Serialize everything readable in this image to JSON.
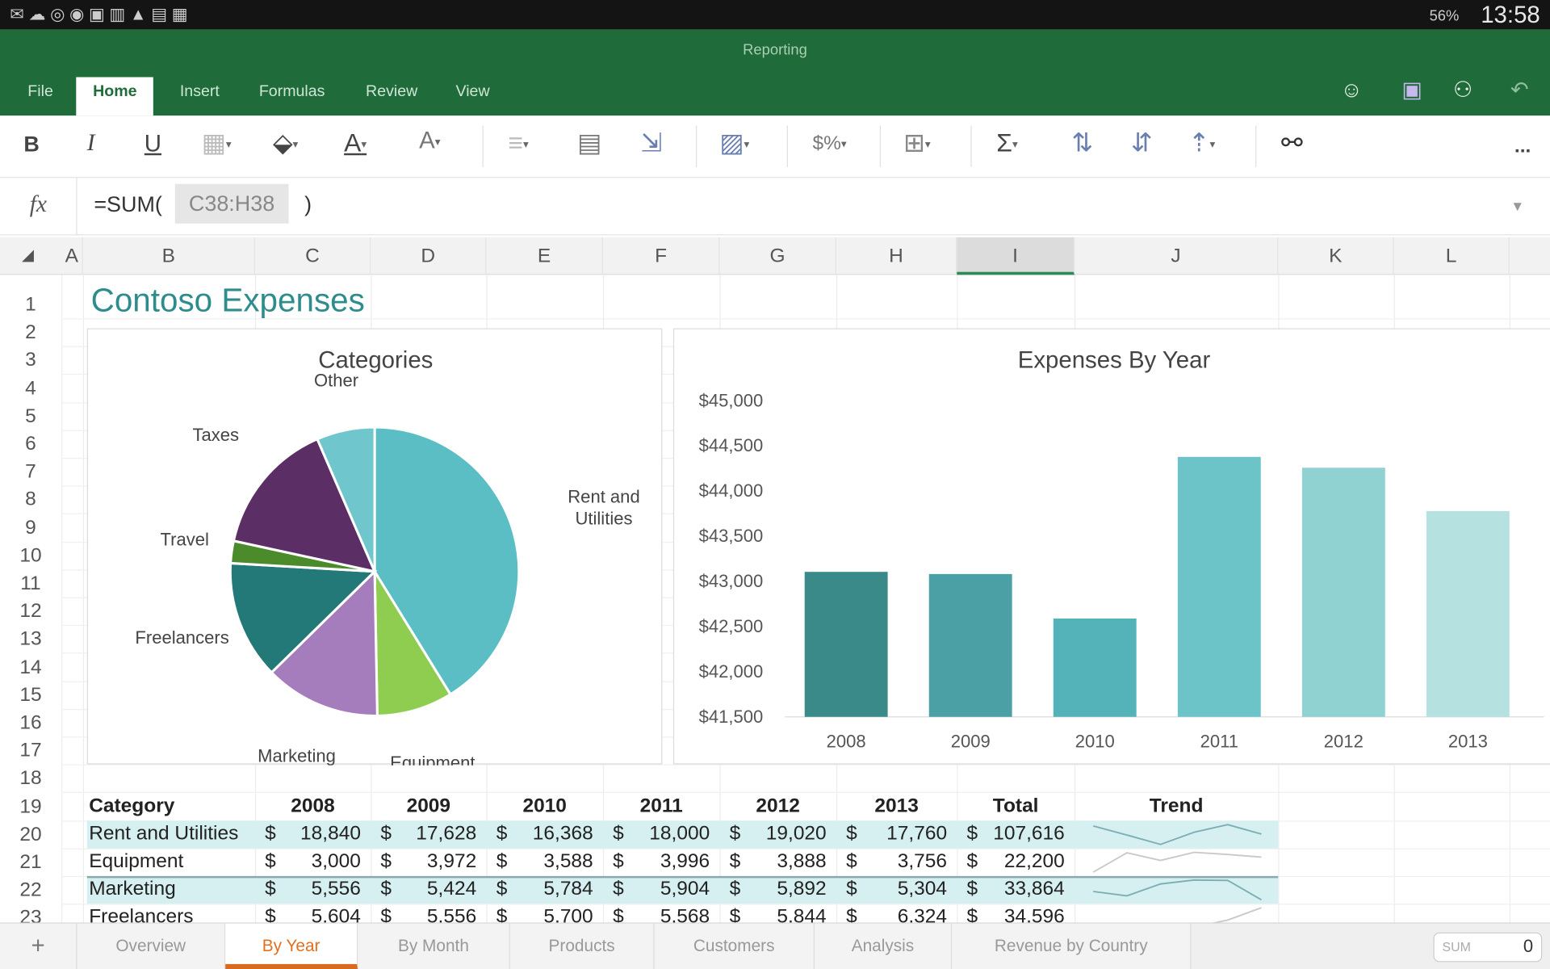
{
  "status": {
    "time": "13:58",
    "battery": "56%"
  },
  "app": {
    "title": "Reporting"
  },
  "ribbon_tabs": [
    {
      "label": "File"
    },
    {
      "label": "Home",
      "active": true
    },
    {
      "label": "Insert"
    },
    {
      "label": "Formulas"
    },
    {
      "label": "Review"
    },
    {
      "label": "View"
    }
  ],
  "ribbon_icons": [
    "smiley-icon",
    "save-icon",
    "share-icon",
    "undo-icon"
  ],
  "toolbar": {
    "bold": "B",
    "italic": "I",
    "underline": "U",
    "sum": "Σ",
    "more": "..."
  },
  "formula": {
    "fx": "fx",
    "prefix": "=SUM(",
    "ref": "C38:H38",
    "suffix": ")"
  },
  "columns": [
    "A",
    "B",
    "C",
    "D",
    "E",
    "F",
    "G",
    "H",
    "I",
    "J",
    "K",
    "L"
  ],
  "selected_column": "I",
  "rows": [
    "1",
    "2",
    "3",
    "4",
    "5",
    "6",
    "7",
    "8",
    "9",
    "10",
    "11",
    "12",
    "13",
    "14",
    "15",
    "16",
    "17",
    "18",
    "19",
    "20",
    "21",
    "22",
    "23"
  ],
  "sheet_title": "Contoso Expenses",
  "table": {
    "headers": [
      "Category",
      "2008",
      "2009",
      "2010",
      "2011",
      "2012",
      "2013",
      "Total",
      "Trend"
    ],
    "rows": [
      {
        "category": "Rent and Utilities",
        "values": [
          "18,840",
          "17,628",
          "16,368",
          "18,000",
          "19,020",
          "17,760"
        ],
        "total": "107,616"
      },
      {
        "category": "Equipment",
        "values": [
          "3,000",
          "3,972",
          "3,588",
          "3,996",
          "3,888",
          "3,756"
        ],
        "total": "22,200"
      },
      {
        "category": "Marketing",
        "values": [
          "5,556",
          "5,424",
          "5,784",
          "5,904",
          "5,892",
          "5,304"
        ],
        "total": "33,864"
      },
      {
        "category": "Freelancers",
        "values": [
          "5,604",
          "5,556",
          "5,700",
          "5,568",
          "5,844",
          "6,324"
        ],
        "total": "34,596"
      }
    ],
    "currency": "$"
  },
  "chart_data": [
    {
      "type": "pie",
      "title": "Categories",
      "labels": [
        "Rent and Utilities",
        "Equipment",
        "Marketing",
        "Freelancers",
        "Travel",
        "Taxes",
        "Other"
      ],
      "values": [
        107616,
        22200,
        33864,
        34596,
        6500,
        39400,
        17000
      ],
      "colors": [
        "#5bbec5",
        "#8fcd50",
        "#a57cbc",
        "#237878",
        "#4b8b2c",
        "#5b2f66",
        "#6fc6cc"
      ]
    },
    {
      "type": "bar",
      "title": "Expenses By Year",
      "categories": [
        "2008",
        "2009",
        "2010",
        "2011",
        "2012",
        "2013"
      ],
      "values": [
        43104,
        43080,
        42588,
        44376,
        44256,
        43776
      ],
      "ylim": [
        41500,
        45000
      ],
      "yticks": [
        "$41,500",
        "$42,000",
        "$42,500",
        "$43,000",
        "$43,500",
        "$44,000",
        "$44,500",
        "$45,000"
      ],
      "colors": [
        "#3b8a8a",
        "#4aa0a4",
        "#54b3b8",
        "#6dc4c8",
        "#90d1d2",
        "#b6e1e1"
      ],
      "grid": false
    }
  ],
  "sheet_tabs": [
    {
      "label": "Overview"
    },
    {
      "label": "By Year",
      "active": true
    },
    {
      "label": "By Month"
    },
    {
      "label": "Products"
    },
    {
      "label": "Customers"
    },
    {
      "label": "Analysis"
    },
    {
      "label": "Revenue by Country"
    }
  ],
  "add_sheet": "+",
  "sum_box": {
    "label": "SUM",
    "value": "0"
  }
}
